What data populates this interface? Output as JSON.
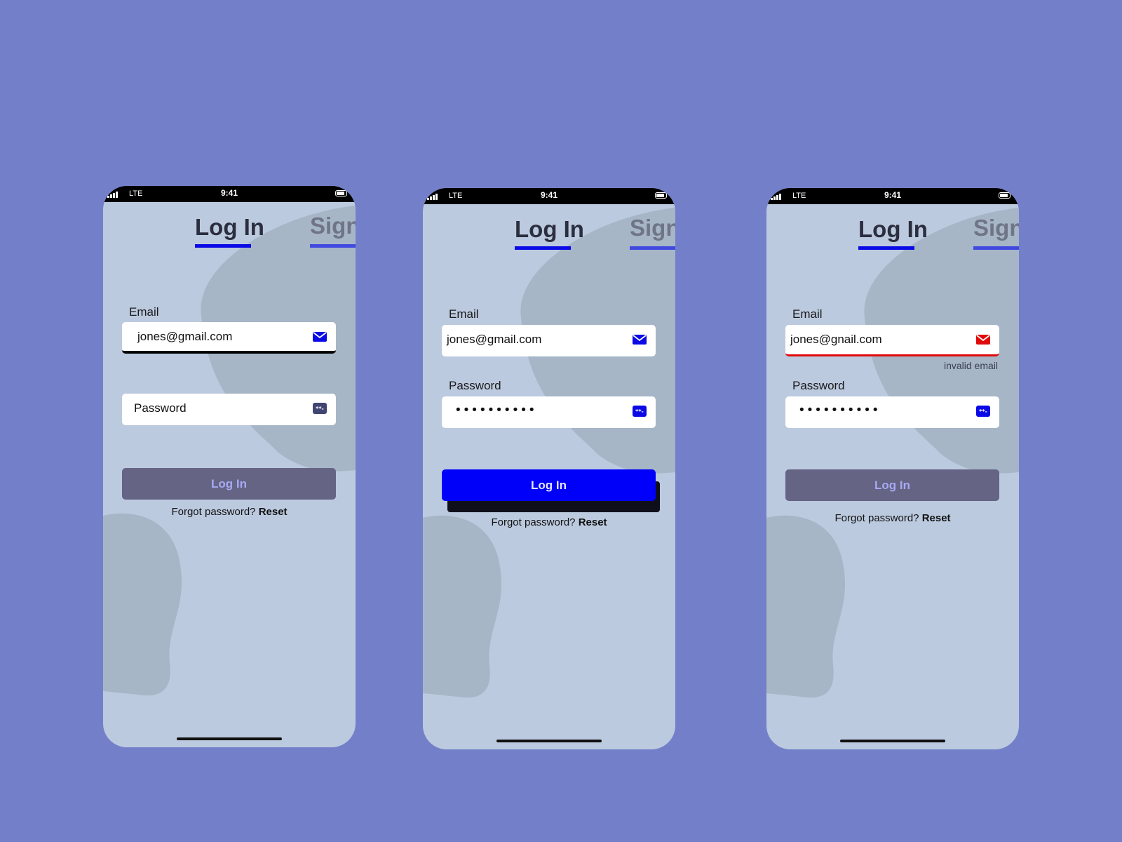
{
  "status_bar": {
    "network": "LTE",
    "time": "9:41"
  },
  "tabs": {
    "login": "Log In",
    "signup": "Sign"
  },
  "screens": [
    {
      "email_label": "Email",
      "email_value": "jones@gmail.com",
      "password_placeholder": "Password",
      "login_button": "Log In",
      "forgot_text": "Forgot password?",
      "reset_link": "Reset"
    },
    {
      "email_label": "Email",
      "email_value": "jones@gmail.com",
      "password_label": "Password",
      "password_value": "••••••••••",
      "login_button": "Log In",
      "forgot_text": "Forgot password?",
      "reset_link": "Reset"
    },
    {
      "email_label": "Email",
      "email_value": "jones@gnail.com",
      "error": "invalid email",
      "password_label": "Password",
      "password_value": "••••••••••",
      "login_button": "Log In",
      "forgot_text": "Forgot password?",
      "reset_link": "Reset"
    }
  ],
  "colors": {
    "background": "#7380c9",
    "screen": "#bccadf",
    "accent": "#0000fa",
    "error": "#e00a0a",
    "disabled_button": "#656484"
  }
}
